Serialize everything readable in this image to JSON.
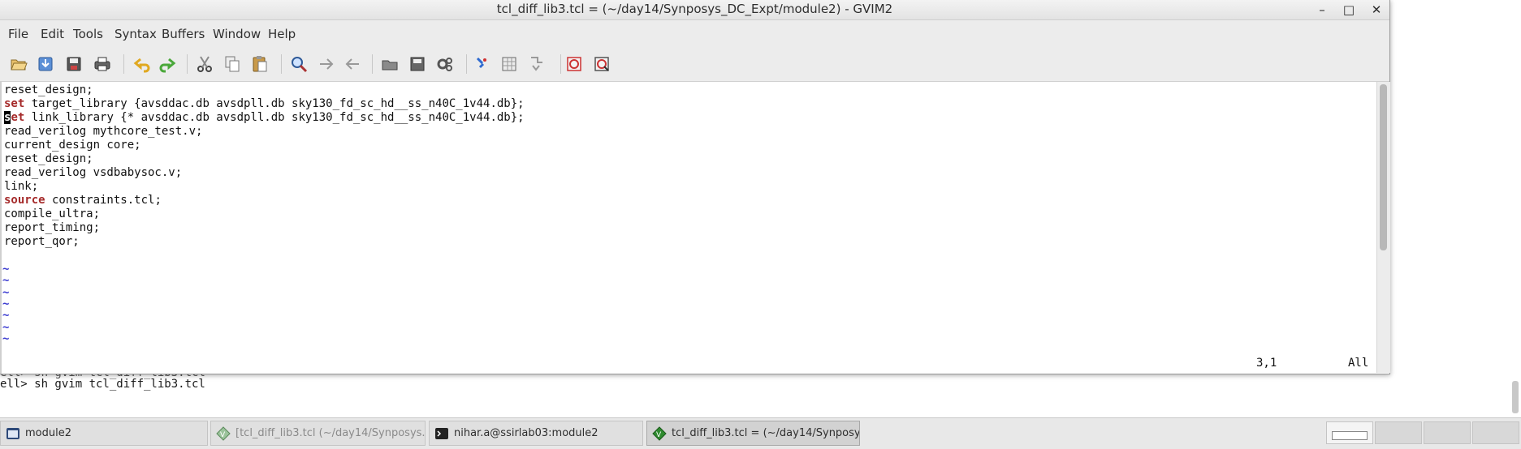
{
  "terminal": {
    "prev_line": "ell> sh gvim tcl_diff_lib3.tcl",
    "prompt_line": "ell> sh gvim tcl_diff_lib3.tcl"
  },
  "window": {
    "title": "tcl_diff_lib3.tcl = (~/day14/Synposys_DC_Expt/module2) - GVIM2",
    "minimize": "–",
    "maximize": "□",
    "close": "✕"
  },
  "menu": [
    "File",
    "Edit",
    "Tools",
    "Syntax",
    "Buffers",
    "Window",
    "Help"
  ],
  "toolbar_icons": [
    "open-icon",
    "save-icon",
    "save-all-icon",
    "print-icon",
    "undo-icon",
    "redo-icon",
    "cut-icon",
    "copy-icon",
    "paste-icon",
    "find-replace-icon",
    "find-next-icon",
    "find-prev-icon",
    "load-session-icon",
    "save-session-icon",
    "run-script-icon",
    "make-icon",
    "shell-icon",
    "ctags-icon",
    "help-icon",
    "find-help-icon"
  ],
  "editor": {
    "lines": [
      {
        "kw": "",
        "text": "reset_design;"
      },
      {
        "kw": "set",
        "text": " target_library {avsddac.db avsdpll.db sky130_fd_sc_hd__ss_n40C_1v44.db};"
      },
      {
        "kw": "set",
        "text": " link_library {* avsddac.db avsdpll.db sky130_fd_sc_hd__ss_n40C_1v44.db};",
        "cursor": true
      },
      {
        "kw": "",
        "text": "read_verilog mythcore_test.v;"
      },
      {
        "kw": "",
        "text": "current_design core;"
      },
      {
        "kw": "",
        "text": "reset_design;"
      },
      {
        "kw": "",
        "text": "read_verilog vsdbabysoc.v;"
      },
      {
        "kw": "",
        "text": "link;"
      },
      {
        "kw": "source",
        "text": " constraints.tcl;"
      },
      {
        "kw": "",
        "text": "compile_ultra;"
      },
      {
        "kw": "",
        "text": "report_timing;"
      },
      {
        "kw": "",
        "text": "report_qor;"
      },
      {
        "kw": "",
        "text": ""
      }
    ],
    "tilde": "~",
    "tilde_count": 7,
    "status_position": "3,1",
    "status_scroll": "All"
  },
  "taskbar": {
    "tasks": [
      {
        "label": "module2",
        "icon": "terminal-icon",
        "state": "normal"
      },
      {
        "label": "[tcl_diff_lib3.tcl (~/day14/Synposys...",
        "icon": "vim-icon",
        "state": "inactive"
      },
      {
        "label": "nihar.a@ssirlab03:module2",
        "icon": "terminal-icon",
        "state": "normal"
      },
      {
        "label": "tcl_diff_lib3.tcl = (~/day14/Synposy...",
        "icon": "vim-icon",
        "state": "active"
      }
    ],
    "workspaces": 4,
    "current_workspace": 1
  },
  "colors": {
    "keyword": "#a52a2a",
    "tilde": "#3a3ad0",
    "chrome": "#ececec"
  }
}
